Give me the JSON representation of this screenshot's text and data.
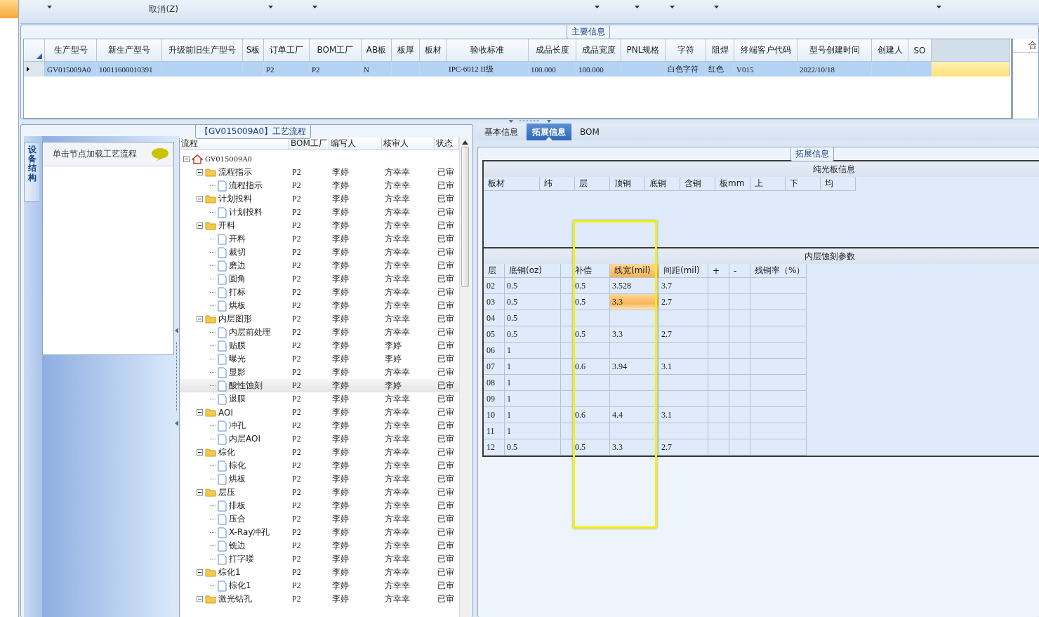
{
  "toolbar": [
    {
      "kind": "dropdown"
    },
    {
      "kind": "text",
      "label": "取消(Z)"
    },
    {
      "kind": "dropdown"
    },
    {
      "kind": "dropdown"
    },
    {
      "kind": "dropdown"
    },
    {
      "kind": "dropdown"
    },
    {
      "kind": "dropdown"
    },
    {
      "kind": "dropdown"
    },
    {
      "kind": "dropdown"
    }
  ],
  "main_info": {
    "title": "主要信息",
    "columns": [
      "生产型号",
      "新生产型号",
      "升级前旧生产型号",
      "S板",
      "订单工厂",
      "BOM工厂",
      "AB板",
      "板厚",
      "板材",
      "验收标准",
      "成品长度",
      "成品宽度",
      "PNL规格",
      "字符",
      "阻焊",
      "终端客户代码",
      "型号创建时间",
      "创建人",
      "SO"
    ],
    "rows": [
      {
        "selected": true,
        "cells": [
          "GV015009A0",
          "10011600010391",
          "",
          "",
          "P2",
          "P2",
          "N",
          "",
          "",
          "IPC-6012 II级",
          "100.000",
          "100.000",
          "",
          "白色字符",
          "红色",
          "V015",
          "2022/10/18",
          "",
          ""
        ]
      }
    ],
    "side_header": "合"
  },
  "process_panel": {
    "title": "【GV015009A0】工艺流程",
    "side_tab": "设备结构",
    "nav_header": "单击节点加载工艺流程",
    "columns": [
      "流程",
      "BOM工厂",
      "编写人",
      "核审人",
      "状态"
    ],
    "tree": [
      {
        "label": "GV015009A0",
        "kind": "root",
        "selected": false,
        "expanded": true,
        "children": [
          {
            "label": "流程指示",
            "kind": "folder",
            "cells": [
              "P2",
              "李婷",
              "方幸幸",
              "已审"
            ],
            "selected": false,
            "expanded": true,
            "children": [
              {
                "label": "流程指示",
                "kind": "item",
                "cells": [
                  "P2",
                  "李婷",
                  "方幸幸",
                  "已审"
                ],
                "selected": false
              }
            ]
          },
          {
            "label": "计划投料",
            "kind": "folder",
            "cells": [
              "P2",
              "李婷",
              "方幸幸",
              "已审"
            ],
            "selected": false,
            "expanded": true,
            "children": [
              {
                "label": "计划投料",
                "kind": "item",
                "cells": [
                  "P2",
                  "李婷",
                  "方幸幸",
                  "已审"
                ],
                "selected": false
              }
            ]
          },
          {
            "label": "开料",
            "kind": "folder",
            "cells": [
              "P2",
              "李婷",
              "方幸幸",
              "已审"
            ],
            "selected": false,
            "expanded": true,
            "children": [
              {
                "label": "开料",
                "kind": "item",
                "cells": [
                  "P2",
                  "李婷",
                  "方幸幸",
                  "已审"
                ],
                "selected": false
              },
              {
                "label": "裁切",
                "kind": "item",
                "cells": [
                  "P2",
                  "李婷",
                  "方幸幸",
                  "已审"
                ],
                "selected": false
              },
              {
                "label": "磨边",
                "kind": "item",
                "cells": [
                  "P2",
                  "李婷",
                  "方幸幸",
                  "已审"
                ],
                "selected": false
              },
              {
                "label": "圆角",
                "kind": "item",
                "cells": [
                  "P2",
                  "李婷",
                  "方幸幸",
                  "已审"
                ],
                "selected": false
              },
              {
                "label": "打标",
                "kind": "item",
                "cells": [
                  "P2",
                  "李婷",
                  "方幸幸",
                  "已审"
                ],
                "selected": false
              },
              {
                "label": "烘板",
                "kind": "item",
                "cells": [
                  "P2",
                  "李婷",
                  "方幸幸",
                  "已审"
                ],
                "selected": false
              }
            ]
          },
          {
            "label": "内层图形",
            "kind": "folder",
            "cells": [
              "P2",
              "李婷",
              "方幸幸",
              "已审"
            ],
            "selected": false,
            "expanded": true,
            "children": [
              {
                "label": "内层前处理",
                "kind": "item",
                "cells": [
                  "P2",
                  "李婷",
                  "方幸幸",
                  "已审"
                ],
                "selected": false
              },
              {
                "label": "贴膜",
                "kind": "item",
                "cells": [
                  "P2",
                  "李婷",
                  "李婷",
                  "已审"
                ],
                "selected": false
              },
              {
                "label": "曝光",
                "kind": "item",
                "cells": [
                  "P2",
                  "李婷",
                  "李婷",
                  "已审"
                ],
                "selected": false
              },
              {
                "label": "显影",
                "kind": "item",
                "cells": [
                  "P2",
                  "李婷",
                  "方幸幸",
                  "已审"
                ],
                "selected": false
              },
              {
                "label": "酸性蚀刻",
                "kind": "item",
                "cells": [
                  "P2",
                  "李婷",
                  "李婷",
                  "已审"
                ],
                "selected": true
              },
              {
                "label": "退膜",
                "kind": "item",
                "cells": [
                  "P2",
                  "李婷",
                  "方幸幸",
                  "已审"
                ],
                "selected": false
              }
            ]
          },
          {
            "label": "AOI",
            "kind": "folder",
            "cells": [
              "P2",
              "李婷",
              "方幸幸",
              "已审"
            ],
            "selected": false,
            "expanded": true,
            "children": [
              {
                "label": "冲孔",
                "kind": "item",
                "cells": [
                  "P2",
                  "李婷",
                  "方幸幸",
                  "已审"
                ],
                "selected": false
              },
              {
                "label": "内层AOI",
                "kind": "item",
                "cells": [
                  "P2",
                  "李婷",
                  "方幸幸",
                  "已审"
                ],
                "selected": false
              }
            ]
          },
          {
            "label": "棕化",
            "kind": "folder",
            "cells": [
              "P2",
              "李婷",
              "方幸幸",
              "已审"
            ],
            "selected": false,
            "expanded": true,
            "children": [
              {
                "label": "棕化",
                "kind": "item",
                "cells": [
                  "P2",
                  "李婷",
                  "方幸幸",
                  "已审"
                ],
                "selected": false
              },
              {
                "label": "烘板",
                "kind": "item",
                "cells": [
                  "P2",
                  "李婷",
                  "方幸幸",
                  "已审"
                ],
                "selected": false
              }
            ]
          },
          {
            "label": "层压",
            "kind": "folder",
            "cells": [
              "P2",
              "李婷",
              "方幸幸",
              "已审"
            ],
            "selected": false,
            "expanded": true,
            "children": [
              {
                "label": "排板",
                "kind": "item",
                "cells": [
                  "P2",
                  "李婷",
                  "方幸幸",
                  "已审"
                ],
                "selected": false
              },
              {
                "label": "压合",
                "kind": "item",
                "cells": [
                  "P2",
                  "李婷",
                  "方幸幸",
                  "已审"
                ],
                "selected": false
              },
              {
                "label": "X-Ray冲孔",
                "kind": "item",
                "cells": [
                  "P2",
                  "李婷",
                  "方幸幸",
                  "已审"
                ],
                "selected": false
              },
              {
                "label": "铣边",
                "kind": "item",
                "cells": [
                  "P2",
                  "李婷",
                  "方幸幸",
                  "已审"
                ],
                "selected": false
              },
              {
                "label": "打字喽",
                "kind": "item",
                "cells": [
                  "P2",
                  "李婷",
                  "方幸幸",
                  "已审"
                ],
                "selected": false
              }
            ]
          },
          {
            "label": "棕化1",
            "kind": "folder",
            "cells": [
              "P2",
              "李婷",
              "方幸幸",
              "已审"
            ],
            "selected": false,
            "expanded": true,
            "children": [
              {
                "label": "棕化1",
                "kind": "item",
                "cells": [
                  "P2",
                  "李婷",
                  "方幸幸",
                  "已审"
                ],
                "selected": false
              }
            ]
          },
          {
            "label": "激光钻孔",
            "kind": "folder",
            "cells": [
              "P2",
              "李婷",
              "方幸幸",
              "已审"
            ],
            "selected": false,
            "expanded": true
          }
        ]
      }
    ]
  },
  "detail_panel": {
    "tabs": [
      {
        "label": "基本信息",
        "selected": false
      },
      {
        "label": "拓展信息",
        "selected": true
      },
      {
        "label": "BOM",
        "selected": false
      }
    ],
    "title": "拓展信息",
    "bare_board": {
      "title": "纯光板信息",
      "columns": [
        "板材",
        "纬",
        "层",
        "顶铜",
        "底铜",
        "含铜",
        "板mm",
        "上",
        "下",
        "均"
      ]
    },
    "inner_etch": {
      "title": "内层蚀刻参数",
      "columns": [
        {
          "label": "层",
          "selected": false
        },
        {
          "label": "底铜(oz)",
          "selected": false
        },
        {
          "label": "补偿",
          "selected": false
        },
        {
          "label": "线宽(mil)",
          "selected": true
        },
        {
          "label": "间距(mil)",
          "selected": false
        },
        {
          "label": "+",
          "selected": false
        },
        {
          "label": "-",
          "selected": false
        },
        {
          "label": "残铜率（%）",
          "selected": false
        }
      ],
      "rows": [
        {
          "selected": false,
          "cells": [
            "02",
            "0.5",
            "0.5",
            "3.528",
            "3.7",
            "",
            "",
            ""
          ]
        },
        {
          "selected": true,
          "cells": [
            "03",
            "0.5",
            "0.5",
            "3.3",
            "2.7",
            "",
            "",
            ""
          ]
        },
        {
          "selected": false,
          "cells": [
            "04",
            "0.5",
            "",
            "",
            "",
            "",
            "",
            ""
          ]
        },
        {
          "selected": false,
          "cells": [
            "05",
            "0.5",
            "0.5",
            "3.3",
            "2.7",
            "",
            "",
            ""
          ]
        },
        {
          "selected": false,
          "cells": [
            "06",
            "1",
            "",
            "",
            "",
            "",
            "",
            ""
          ]
        },
        {
          "selected": false,
          "cells": [
            "07",
            "1",
            "0.6",
            "3.94",
            "3.1",
            "",
            "",
            ""
          ]
        },
        {
          "selected": false,
          "cells": [
            "08",
            "1",
            "",
            "",
            "",
            "",
            "",
            ""
          ]
        },
        {
          "selected": false,
          "cells": [
            "09",
            "1",
            "",
            "",
            "",
            "",
            "",
            ""
          ]
        },
        {
          "selected": false,
          "cells": [
            "10",
            "1",
            "0.6",
            "4.4",
            "3.1",
            "",
            "",
            ""
          ]
        },
        {
          "selected": false,
          "cells": [
            "11",
            "1",
            "",
            "",
            "",
            "",
            "",
            ""
          ]
        },
        {
          "selected": false,
          "cells": [
            "12",
            "0.5",
            "0.5",
            "3.3",
            "2.7",
            "",
            "",
            ""
          ]
        }
      ]
    }
  }
}
